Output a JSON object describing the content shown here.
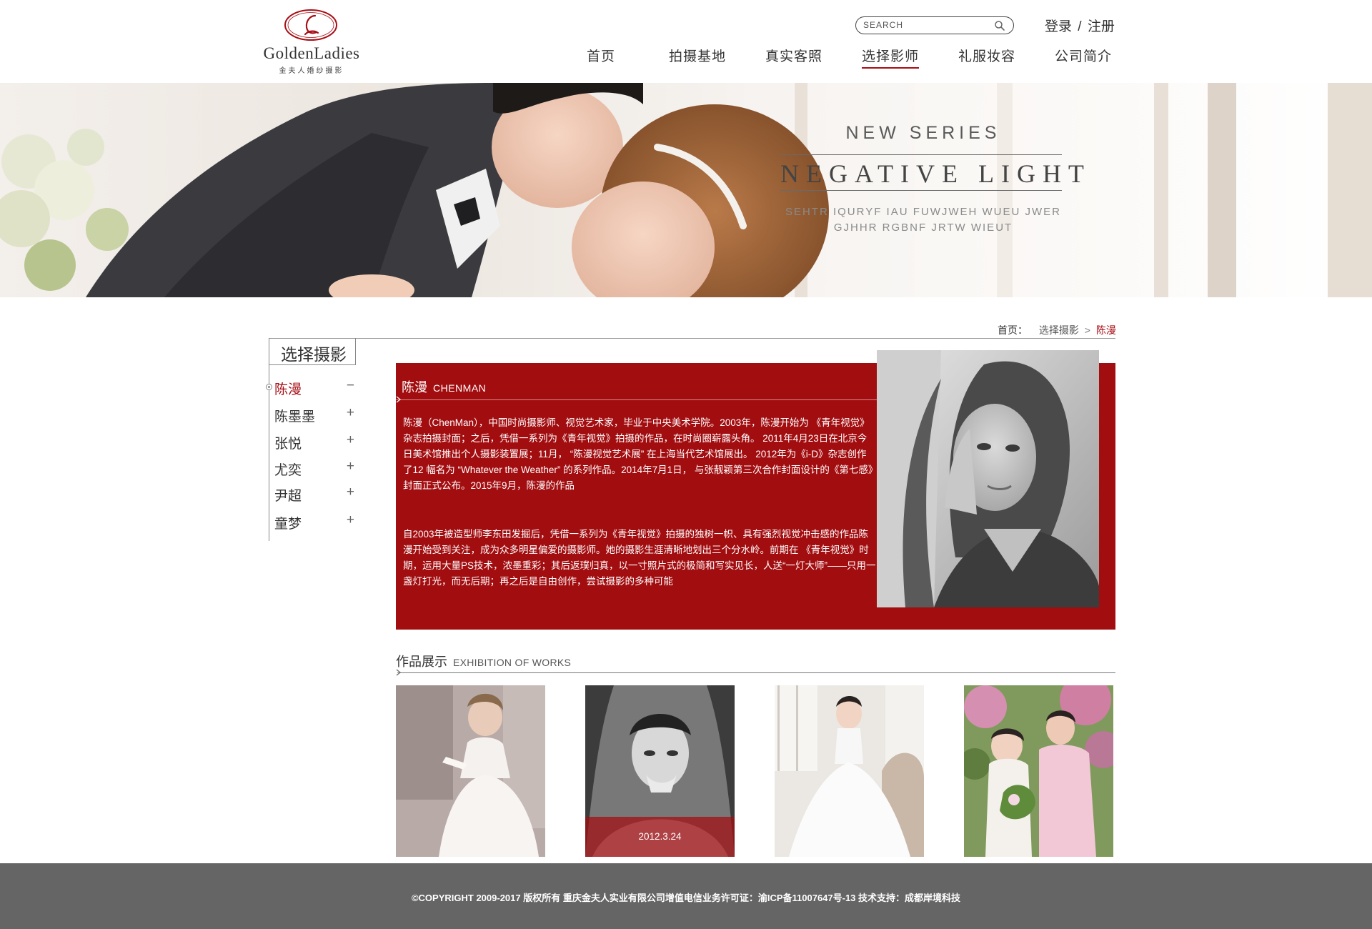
{
  "header": {
    "logo": {
      "brand": "GoldenLadies",
      "subtitle": "金夫人婚纱摄影",
      "mark_letter": "L"
    },
    "search": {
      "placeholder": "SEARCH"
    },
    "auth": {
      "login": "登录",
      "separator": "/",
      "register": "注册"
    },
    "nav": [
      {
        "label": "首页",
        "active": false
      },
      {
        "label": "拍摄基地",
        "active": false
      },
      {
        "label": "真实客照",
        "active": false
      },
      {
        "label": "选择影师",
        "active": true
      },
      {
        "label": "礼服妆容",
        "active": false
      },
      {
        "label": "公司简介",
        "active": false
      }
    ]
  },
  "banner": {
    "series": "NEW SERIES",
    "title": "NEGATIVE LIGHT",
    "subtitle_line1": "SEHTR IQURYF IAU FUWJWEH WUEU JWER",
    "subtitle_line2": "GJHHR RGBNF JRTW WIEUT"
  },
  "breadcrumb": {
    "home": "首页：",
    "section": "选择摄影",
    "separator": ">",
    "current": "陈漫"
  },
  "sidebar": {
    "title": "选择摄影",
    "items": [
      {
        "label": "陈漫",
        "sign": "−",
        "active": true
      },
      {
        "label": "陈墨墨",
        "sign": "+",
        "active": false
      },
      {
        "label": "张悦",
        "sign": "+",
        "active": false
      },
      {
        "label": "尤奕",
        "sign": "+",
        "active": false
      },
      {
        "label": "尹超",
        "sign": "+",
        "active": false
      },
      {
        "label": "童梦",
        "sign": "+",
        "active": false
      }
    ]
  },
  "profile": {
    "name_cn": "陈漫",
    "name_en": "CHENMAN",
    "paragraph1": "陈漫（ChenMan），中国时尚摄影师、视觉艺术家，毕业于中央美术学院。2003年，陈漫开始为 《青年视觉》杂志拍摄封面；之后，凭借一系列为《青年视觉》拍摄的作品，在时尚圈崭露头角。 2011年4月23日在北京今日美术馆推出个人摄影装置展；11月， “陈漫视觉艺术展” 在上海当代艺术馆展出。 2012年为《i-D》杂志创作了12 幅名为 “Whatever the Weather” 的系列作品。2014年7月1日， 与张靓颖第三次合作封面设计的《第七感》封面正式公布。2015年9月，陈漫的作品",
    "paragraph2": "自2003年被造型师李东田发掘后，凭借一系列为《青年视觉》拍摄的独树一帜、具有强烈视觉冲击感的作品陈漫开始受到关注，成为众多明星偏爱的摄影师。她的摄影生涯清晰地划出三个分水岭。前期在 《青年视觉》时期，运用大量PS技术，浓墨重彩；其后返璞归真，以一寸照片式的极简和写实见长，人送“一灯大师”——只用一盏灯打光，而无后期；再之后是自由创作，尝试摄影的多种可能"
  },
  "works": {
    "title_cn": "作品展示",
    "title_en": "EXHIBITION OF WORKS",
    "items": [
      {
        "name": "bride-reading",
        "date": ""
      },
      {
        "name": "bride-veil-bw",
        "date": "2012.3.24"
      },
      {
        "name": "bride-white-gown",
        "date": ""
      },
      {
        "name": "couple-garden",
        "date": ""
      }
    ]
  },
  "footer": {
    "text": "©COPYRIGHT 2009-2017 版权所有 重庆金夫人实业有限公司增值电信业务许可证：渝ICP备11007647号-13  技术支持：成都岸境科技"
  },
  "colors": {
    "accent": "#a20d10",
    "footer_bg": "#656565",
    "text": "#333333"
  }
}
